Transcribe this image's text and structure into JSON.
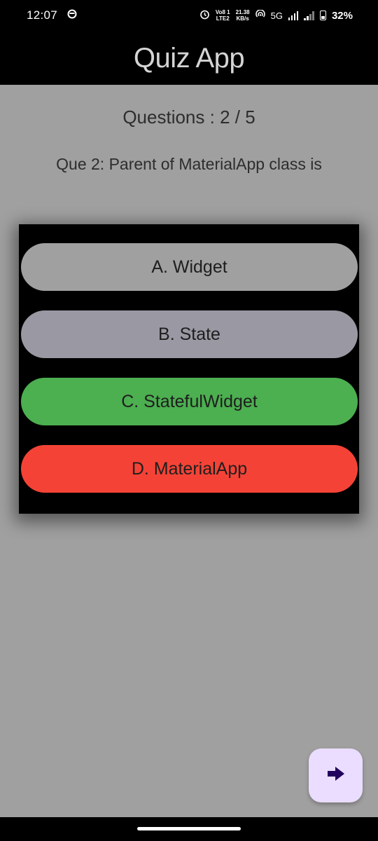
{
  "status_bar": {
    "time": "12:07",
    "volte_top": "Vo8 1",
    "volte_bottom": "LTE2",
    "speed_top": "21.38",
    "speed_bottom": "KB/s",
    "network": "5G",
    "battery": "32%"
  },
  "app_bar": {
    "title": "Quiz App"
  },
  "quiz": {
    "counter": "Questions : 2 / 5",
    "question": "Que 2: Parent of MaterialApp class is",
    "options": [
      {
        "label": "A. Widget",
        "color": "#a0a0a0"
      },
      {
        "label": "B. State",
        "color": "#9a99a3"
      },
      {
        "label": "C. StatefulWidget",
        "color": "#4caf50"
      },
      {
        "label": "D. MaterialApp",
        "color": "#f44336"
      }
    ]
  },
  "fab": {
    "icon": "arrow-right-icon",
    "color": "#eaddff",
    "icon_color": "#21005d"
  },
  "colors": {
    "background": "#a0a0a0",
    "app_bar": "#000000",
    "title": "#d4d4d4"
  }
}
